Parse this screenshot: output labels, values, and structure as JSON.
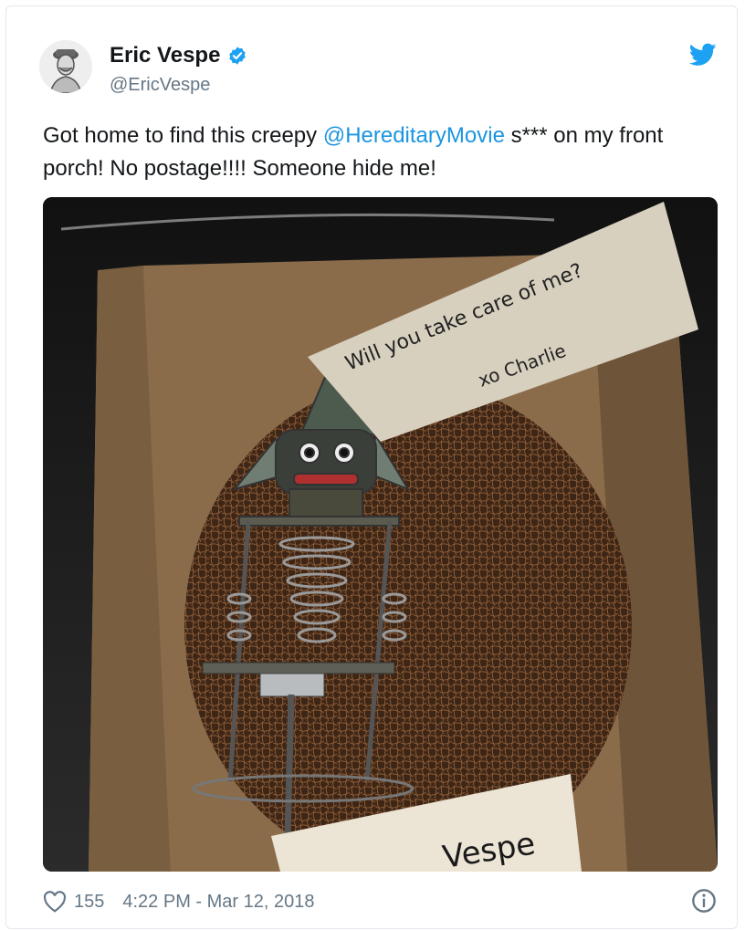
{
  "tweet": {
    "display_name": "Eric Vespe",
    "handle": "@EricVespe",
    "text_before": "Got home to find this creepy ",
    "mention": "@HereditaryMovie",
    "text_after": " s*** on my front porch! No postage!!!! Someone hide me!",
    "photo": {
      "note_line1": "Will you take care of me?",
      "note_line2": "xo Charlie",
      "label_text": "Vespe"
    },
    "likes": "155",
    "timestamp": "4:22 PM - Mar 12, 2018"
  },
  "icons": {
    "verified": "verified-badge-icon",
    "brand": "twitter-bird-icon",
    "like": "heart-icon",
    "info": "info-icon"
  },
  "colors": {
    "link": "#1b95e0",
    "verified": "#1da1f2",
    "muted": "#657786",
    "text": "#14171a"
  }
}
